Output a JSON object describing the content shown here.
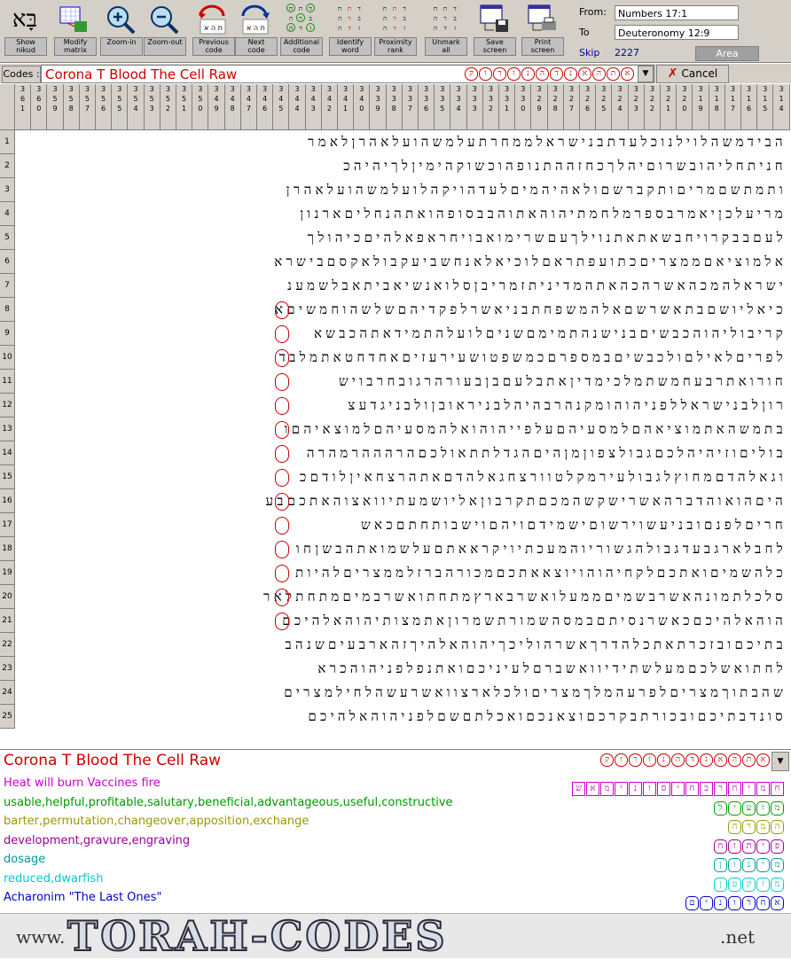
{
  "toolbar": {
    "buttons": [
      {
        "label": "Show\nnikud",
        "icon": "nikud-icon"
      },
      {
        "label": "Modify\nmatrix",
        "icon": "matrix-icon"
      },
      {
        "label": "Zoom-in",
        "icon": "zoom-in-icon"
      },
      {
        "label": "Zoom-out",
        "icon": "zoom-out-icon"
      },
      {
        "label": "Previous\ncode",
        "icon": "previous-code-icon"
      },
      {
        "label": "Next\ncode",
        "icon": "next-code-icon"
      },
      {
        "label": "Additional\ncode",
        "icon": "additional-code-icon"
      },
      {
        "label": "Identify\nword",
        "icon": "identify-word-icon"
      },
      {
        "label": "Proximity\nrank",
        "icon": "proximity-icon"
      },
      {
        "label": "Unmark\nall",
        "icon": "unmark-icon"
      },
      {
        "label": "Save\nscreen",
        "icon": "save-screen-icon"
      },
      {
        "label": "Print\nscreen",
        "icon": "print-screen-icon"
      }
    ],
    "nikud_glyph": "בָּא"
  },
  "reference": {
    "from_label": "From:",
    "from_value": "Numbers 17:1",
    "to_label": "To",
    "to_value": "Deuteronomy 12:9",
    "skip_label": "Skip",
    "skip_value": "2227",
    "area_label": "Area"
  },
  "codes": {
    "label": "Codes :",
    "value": "Corona T Blood The Cell Raw",
    "letters": [
      "א",
      "ת",
      "ה",
      "א",
      "נ",
      "ד",
      "ה",
      "נ",
      "ו",
      "ר",
      "ו",
      "ק"
    ],
    "cancel_label": "Cancel"
  },
  "grid": {
    "columns": [
      "361",
      "360",
      "359",
      "358",
      "357",
      "356",
      "355",
      "354",
      "353",
      "352",
      "351",
      "350",
      "349",
      "348",
      "347",
      "346",
      "345",
      "344",
      "343",
      "342",
      "341",
      "340",
      "339",
      "338",
      "337",
      "336",
      "335",
      "334",
      "333",
      "332",
      "331",
      "330",
      "329",
      "328",
      "327",
      "326",
      "325",
      "324",
      "323",
      "322",
      "321",
      "320",
      "319",
      "318",
      "317",
      "316",
      "315",
      "314"
    ],
    "rows": [
      "הבידמשהלוילנוכלעדתבנישראלממחרתעלמשהועלאהרןלאמר",
      "חניתחליהובשרוםיהלךכחזההתנופהוכשוקהימיןלךיהיהכ",
      "ותמתשםמריםותקברשםולאהיהמיםלעדהויקהלועלמשהועלאהרן",
      "מריעלכןיאמרבספרמלחמתיהוהאתוהבבסופהואתהנחליםארנון",
      "לעםבבקרויחבשאתאתנוילךעםשרימואבויחראפאלהיםכיהולך",
      "אלמוציאםממצריםכתועפתראםלוכיאלאנחשביעקבולאקסםבישרא",
      "ישראלהמכהאשרהכהאתהמדיניתזמריבןסלואנשיאביתאבלשמענ",
      "כיאליושםבתאשרשםאלהמשפחתבניאשרלפקדיהםשלשהוחמשיםא",
      "קריבוליהוהכבשיםבנישנהתמימםשניםלועלהתמידאתהכבשא",
      "לפריםלאילםולכבשיםבמספרםכמשפטושעירעזיםאחדחטאתמלבד",
      "חורואתרבעחמשתמלכימדיןאתבלעםבןבעורהרגובחרבויש",
      "רוןלבנישראללפניהוהומקנהרבהיהלבניראובןולבניגדעצ",
      "בתמשהאתמוציאהםלמסעיהםעלפייהוהואלהמסעיהםלמוצאיהםו",
      "בוליםוזיהיהלכםגבולצפוןמןהיםהגדלתתאולכםהרהההרמהרה",
      "וגאלהדםמחוץלגבולעירמקלטוורצחגאלהדםאתהרצחאיןלודםכ",
      "היםהואוהדברהאשרישקשהמכםתקרבוןאליושמעתיוואצוהאתכםבע",
      "חריםלפנםובניעשוירשוםישמידםויהםוישבותחתםכאש",
      "לחבלארגבעדגבולהגשוריוהמעכתיויקראאתםעלשמואתהבשןחו",
      "כלהשמיםואתכםלקחיהוהויוצאאתכםמכורהברזלממצריםלהיות",
      "סלכלתמונהאשרבשמיםממעלואשרבארץמתחתואשרבמיםמתחתלאר",
      "הוהאלהיכםכאשרנסיתםבמסהשמורתשמרוןאתמצותיהוהאלהיכם",
      "בתיכםובזכרתאתכלהדרךאשרהוליכךיהוהאלהיךזהארבעיםשנהב",
      "לחתואשלכםמעלשתידיוואשברםלעיניכםואתנפלפניהוהכרא",
      "שהבתוךמצריםלפרעהמלךמצריםולכלארצוואשרעשהלחילמצרים",
      "סונדבתיכםובכורתבקרכםוצאנכםואכלתםשםלפניהוהאלהיכם"
    ]
  },
  "panel": {
    "title": "Corona T Blood The Cell Raw",
    "title_letters": [
      "א",
      "ת",
      "ה",
      "א",
      "נ",
      "ד",
      "ה",
      "נ",
      "ו",
      "ר",
      "ו",
      "ק"
    ],
    "items": [
      {
        "text": "Heat will burn Vaccines fire",
        "color": "#cc00cc",
        "letters": [
          "ח",
          "מ",
          "י",
          "ח",
          "ר",
          "ב",
          "ח",
          "י",
          "ס",
          "ו",
          "נ",
          "י",
          "מ",
          "א",
          "ש"
        ]
      },
      {
        "text": "usable,helpful,profitable,salutary,beneficial,advantageous,useful,constructive",
        "color": "#009900",
        "letters": [
          "מ",
          "ו",
          "ע",
          "י",
          "ל"
        ]
      },
      {
        "text": "barter,permutation,changeover,apposition,exchange",
        "color": "#999900",
        "letters": [
          "ה",
          "מ",
          "ר",
          "ה"
        ]
      },
      {
        "text": "development,gravure,engraving",
        "color": "#990099",
        "letters": [
          "פ",
          "י",
          "ת",
          "ו",
          "ח"
        ]
      },
      {
        "text": "dosage",
        "color": "#009999",
        "letters": [
          "מ",
          "י",
          "נ",
          "ו",
          "ן"
        ]
      },
      {
        "text": "reduced,dwarfish",
        "color": "#00cccc",
        "letters": [
          "מ",
          "ו",
          "ק",
          "ט",
          "ן"
        ]
      },
      {
        "text": "Acharonim \"The Last Ones\"",
        "color": "#0000cc",
        "letters": [
          "א",
          "ח",
          "ר",
          "ו",
          "נ",
          "י",
          "ם"
        ]
      }
    ]
  },
  "banner": {
    "www": "www.",
    "main": "TORAH-CODES",
    "net": ".net"
  }
}
